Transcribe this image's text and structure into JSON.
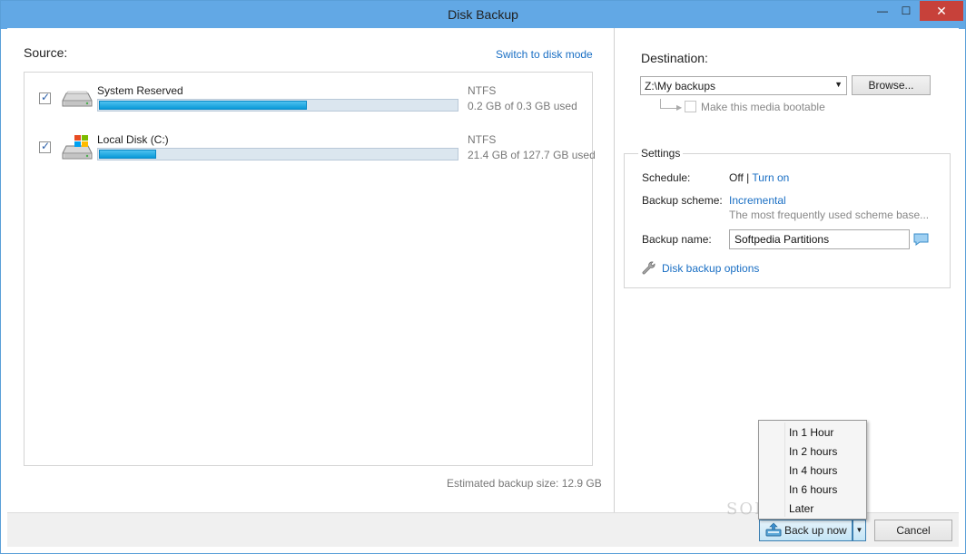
{
  "window": {
    "title": "Disk Backup",
    "minimize_glyph": "—",
    "maximize_glyph": "☐",
    "close_glyph": "✕"
  },
  "source": {
    "label": "Source:",
    "switch_link": "Switch to disk mode",
    "disks": [
      {
        "name": "System Reserved",
        "checked": true,
        "filesystem": "NTFS",
        "usage_text": "0.2 GB of 0.3 GB used",
        "used_fraction": 0.58,
        "icon": "drive-icon"
      },
      {
        "name": "Local Disk (C:)",
        "checked": true,
        "filesystem": "NTFS",
        "usage_text": "21.4 GB of 127.7 GB used",
        "used_fraction": 0.16,
        "icon": "windows-drive-icon"
      }
    ],
    "estimated_size": "Estimated backup size: 12.9 GB"
  },
  "destination": {
    "label": "Destination:",
    "path": "Z:\\My backups",
    "browse_label": "Browse...",
    "bootable_label": "Make this media bootable",
    "bootable_checked": false
  },
  "settings": {
    "title": "Settings",
    "schedule_label": "Schedule:",
    "schedule_value": "Off",
    "schedule_separator": "|",
    "schedule_link": "Turn on",
    "scheme_label": "Backup scheme:",
    "scheme_value": "Incremental",
    "scheme_desc": "The most frequently used scheme base...",
    "name_label": "Backup name:",
    "name_value": "Softpedia Partitions",
    "options_link": "Disk backup options"
  },
  "footer": {
    "backup_now_label": "Back up now",
    "cancel_label": "Cancel"
  },
  "backup_menu": {
    "items": [
      "In 1 Hour",
      "In 2 hours",
      "In 4 hours",
      "In 6 hours",
      "Later"
    ]
  },
  "watermark": "SOFTPEDIA",
  "colors": {
    "accent": "#62a8e5",
    "link": "#1a6fc4",
    "progress": "#0a9ad8",
    "close": "#c7413a"
  }
}
